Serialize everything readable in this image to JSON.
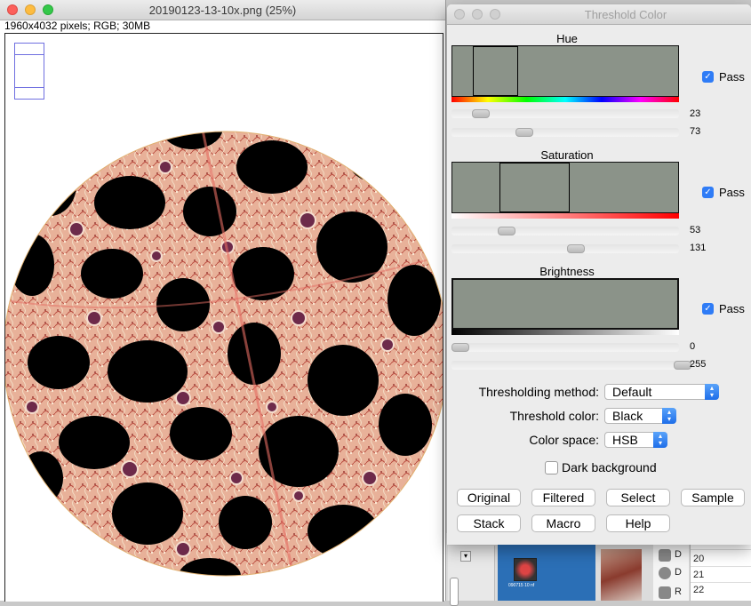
{
  "image_window": {
    "title": "20190123-13-10x.png (25%)",
    "info": "1960x4032 pixels; RGB; 30MB"
  },
  "threshold_window": {
    "title": "Threshold Color",
    "hue": {
      "label": "Hue",
      "pass_label": "Pass",
      "pass_checked": true,
      "min": "23",
      "max": "73"
    },
    "saturation": {
      "label": "Saturation",
      "pass_label": "Pass",
      "pass_checked": true,
      "min": "53",
      "max": "131"
    },
    "brightness": {
      "label": "Brightness",
      "pass_label": "Pass",
      "pass_checked": true,
      "min": "0",
      "max": "255"
    },
    "thresholding_method": {
      "label": "Thresholding method:",
      "value": "Default"
    },
    "threshold_color": {
      "label": "Threshold color:",
      "value": "Black"
    },
    "color_space": {
      "label": "Color space:",
      "value": "HSB"
    },
    "dark_background": {
      "label": "Dark background",
      "checked": false
    },
    "buttons": [
      "Original",
      "Filtered",
      "Select",
      "Sample",
      "Stack",
      "Macro",
      "Help"
    ]
  },
  "desktop": {
    "side_items": [
      "D",
      "D",
      "R"
    ],
    "row_numbers": [
      "20",
      "21",
      "22"
    ],
    "thumb_caption": "090715 10 nf"
  },
  "colors": {
    "histogram_bg": "#8b9389",
    "accent": "#2f7cf6",
    "tissue": "#e9b49b",
    "nuclei": "#6d2a4a"
  },
  "icons": {
    "checkbox": "checkmark-icon",
    "dropdown": "chevron-updown-icon"
  }
}
